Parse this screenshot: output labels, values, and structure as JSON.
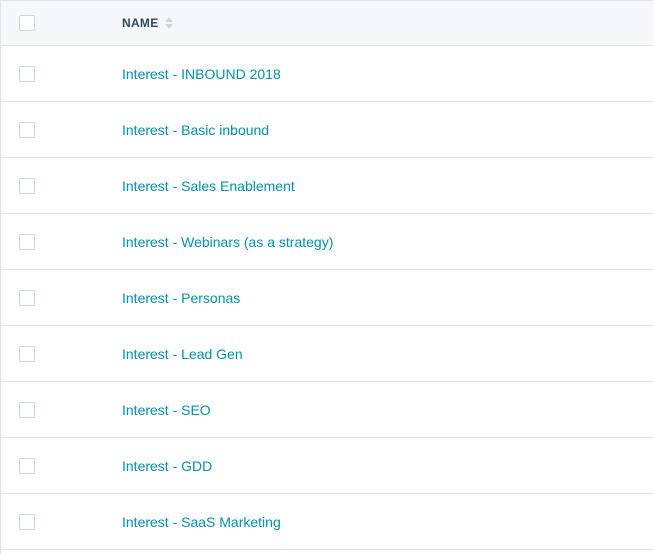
{
  "table": {
    "header": {
      "name_label": "NAME",
      "sort_icon": "sort-both-icon"
    },
    "rows": [
      {
        "name": "Interest - INBOUND 2018"
      },
      {
        "name": "Interest - Basic inbound"
      },
      {
        "name": "Interest - Sales Enablement"
      },
      {
        "name": "Interest - Webinars (as a strategy)"
      },
      {
        "name": "Interest - Personas"
      },
      {
        "name": "Interest - Lead Gen"
      },
      {
        "name": "Interest - SEO"
      },
      {
        "name": "Interest - GDD"
      },
      {
        "name": "Interest - SaaS Marketing"
      }
    ]
  },
  "colors": {
    "link": "#0091ae",
    "header_text": "#33475b",
    "header_bg": "#f5f8fa",
    "border": "#dfe3eb",
    "checkbox_border": "#cbd6e2"
  }
}
